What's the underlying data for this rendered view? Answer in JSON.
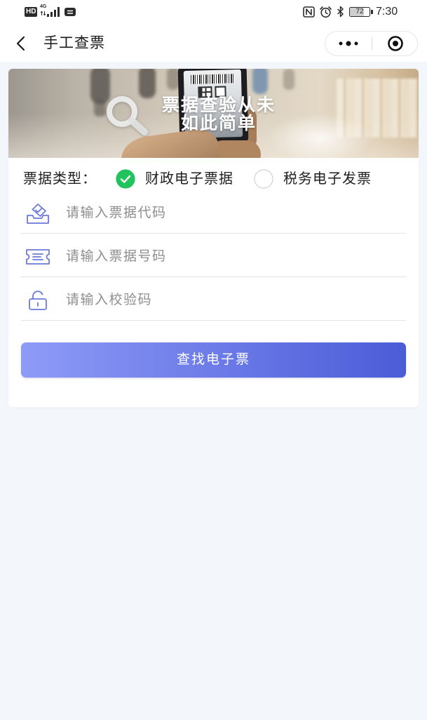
{
  "status_bar": {
    "hd_label": "HD",
    "network": "4G",
    "battery": "72",
    "time": "7:30",
    "left_icons": [
      "signal-bars-icon",
      "message-icon"
    ],
    "right_icons": [
      "nfc-icon",
      "alarm-clock-icon",
      "bluetooth-icon",
      "battery-icon"
    ]
  },
  "nav": {
    "title": "手工查票",
    "back_icon": "chevron-left-icon",
    "more_icon": "more-dots-icon",
    "close_icon": "target-circle-icon"
  },
  "banner": {
    "line1": "票据查验从未",
    "line2": "如此简单",
    "icon": "magnifier-icon"
  },
  "ticket_type": {
    "label": "票据类型：",
    "options": [
      {
        "label": "财政电子票据",
        "selected": true
      },
      {
        "label": "税务电子发票",
        "selected": false
      }
    ]
  },
  "form": {
    "fields": [
      {
        "icon": "stamp-check-icon",
        "placeholder": "请输入票据代码",
        "value": ""
      },
      {
        "icon": "ticket-icon",
        "placeholder": "请输入票据号码",
        "value": ""
      },
      {
        "icon": "lock-icon",
        "placeholder": "请输入校验码",
        "value": ""
      }
    ],
    "submit_label": "查找电子票"
  },
  "colors": {
    "accent_green": "#22c25d",
    "button_gradient_start": "#8e9bf7",
    "button_gradient_end": "#4b5cd8",
    "form_icon": "#6c7ad9",
    "page_background": "#f3f6fa"
  }
}
